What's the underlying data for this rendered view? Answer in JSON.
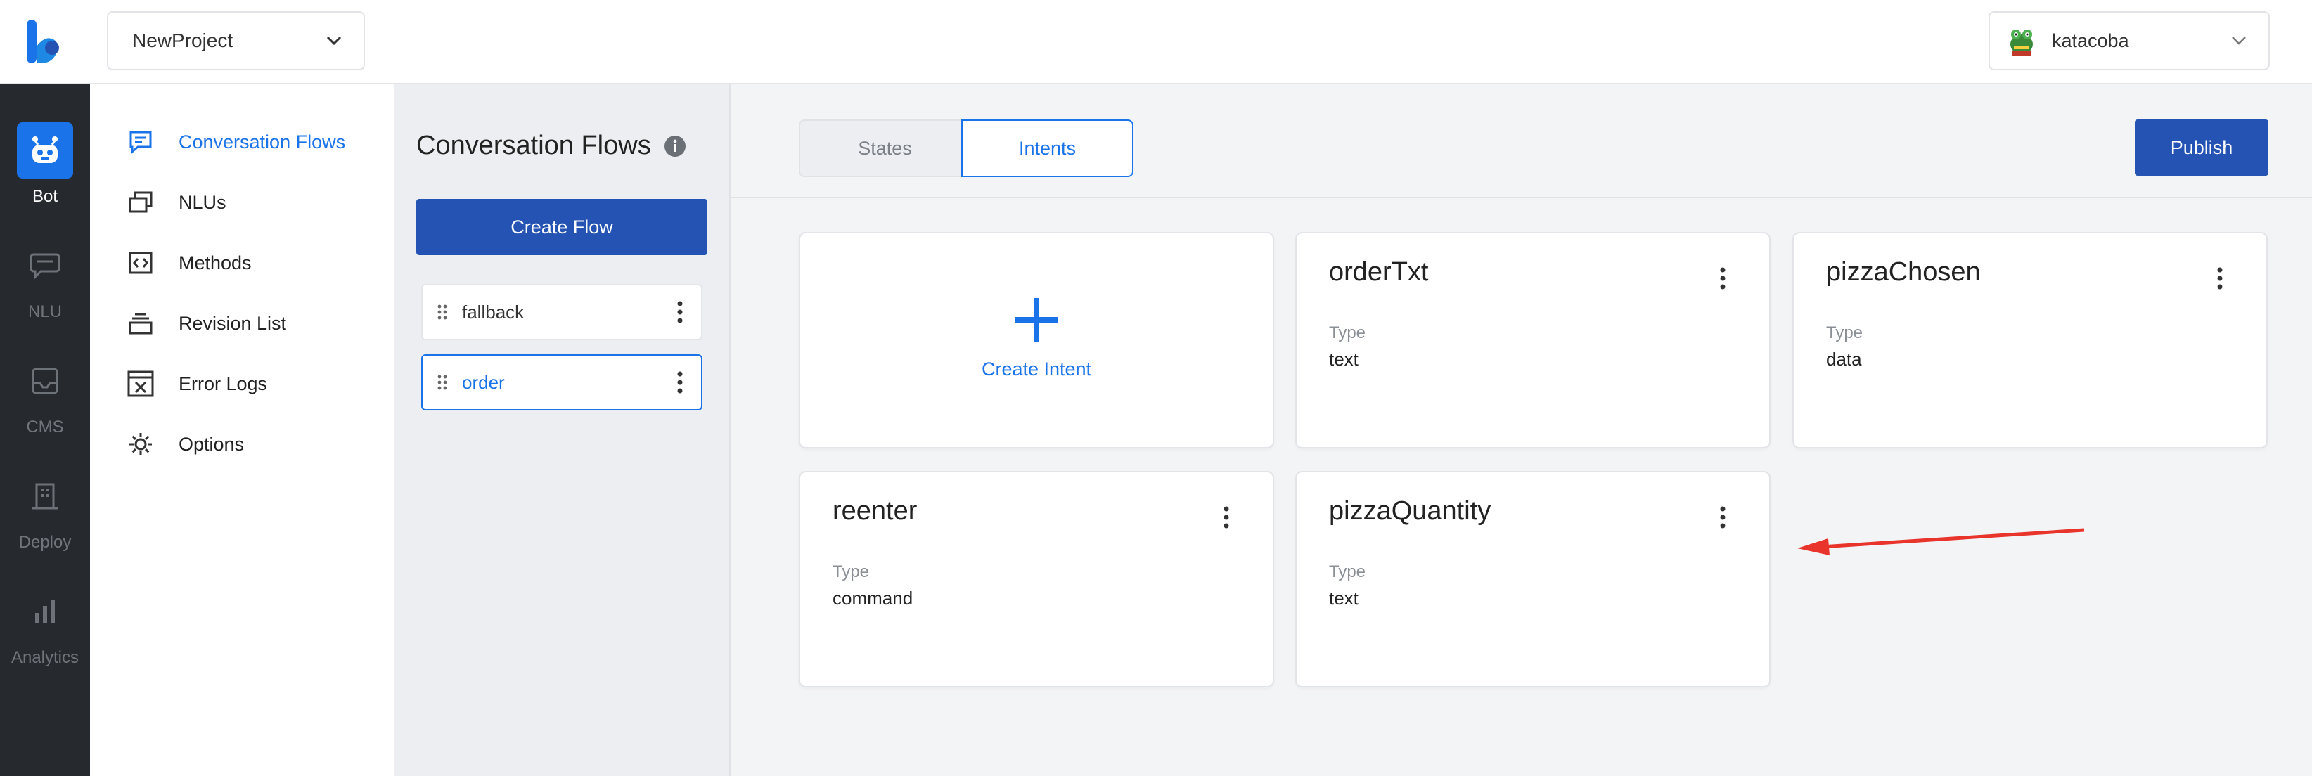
{
  "header": {
    "project": "NewProject",
    "user": "katacoba"
  },
  "rail": {
    "items": [
      {
        "label": "Bot",
        "icon": "bot-icon"
      },
      {
        "label": "NLU",
        "icon": "nlu-icon"
      },
      {
        "label": "CMS",
        "icon": "cms-icon"
      },
      {
        "label": "Deploy",
        "icon": "deploy-icon"
      },
      {
        "label": "Analytics",
        "icon": "analytics-icon"
      }
    ]
  },
  "subnav": {
    "items": [
      {
        "label": "Conversation Flows",
        "icon": "chat-icon"
      },
      {
        "label": "NLUs",
        "icon": "nlu-stack-icon"
      },
      {
        "label": "Methods",
        "icon": "code-icon"
      },
      {
        "label": "Revision List",
        "icon": "stack-icon"
      },
      {
        "label": "Error Logs",
        "icon": "error-log-icon"
      },
      {
        "label": "Options",
        "icon": "gear-icon"
      }
    ]
  },
  "flows": {
    "title": "Conversation Flows",
    "create_label": "Create Flow",
    "items": [
      {
        "label": "fallback"
      },
      {
        "label": "order"
      }
    ]
  },
  "tabs": {
    "states": "States",
    "intents": "Intents"
  },
  "publish_label": "Publish",
  "create_intent_label": "Create Intent",
  "type_label": "Type",
  "intents": [
    {
      "name": "orderTxt",
      "type": "text"
    },
    {
      "name": "pizzaChosen",
      "type": "data"
    },
    {
      "name": "reenter",
      "type": "command"
    },
    {
      "name": "pizzaQuantity",
      "type": "text"
    }
  ],
  "colors": {
    "accent": "#1a73e8",
    "primary_button": "#2453b3",
    "rail": "#262a2f",
    "annotation_arrow": "#e8342a"
  }
}
